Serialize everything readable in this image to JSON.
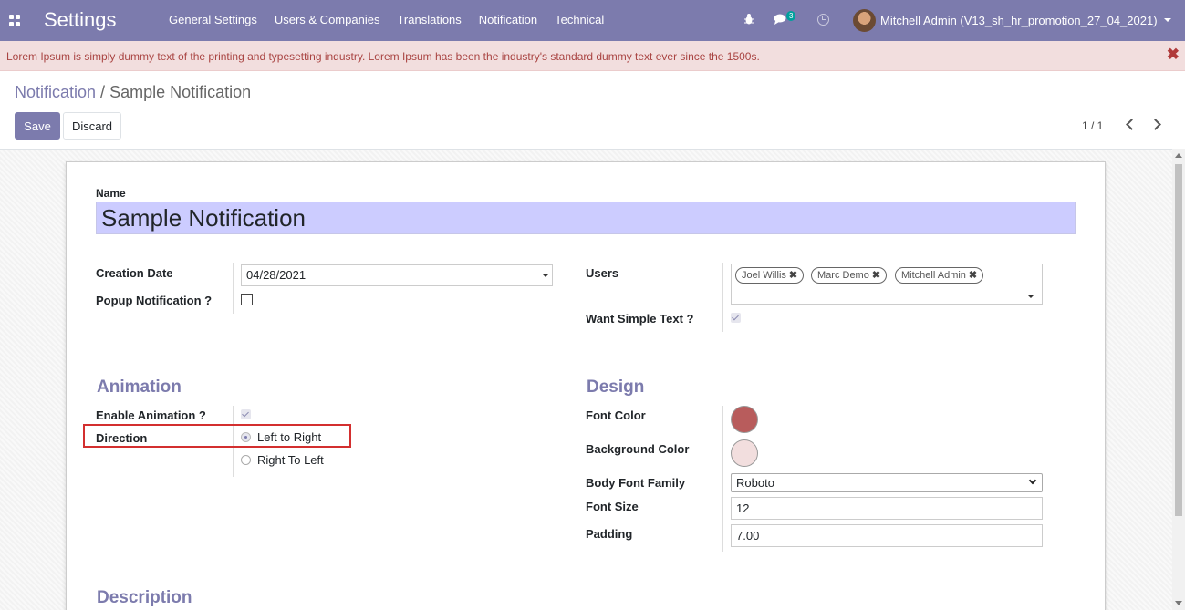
{
  "navbar": {
    "brand": "Settings",
    "menu": [
      "General Settings",
      "Users & Companies",
      "Translations",
      "Notification",
      "Technical"
    ],
    "chat_count": "3",
    "user": "Mitchell Admin (V13_sh_hr_promotion_27_04_2021)",
    "colors": {
      "bar": "#7c7bad"
    },
    "icons": [
      "apps-icon",
      "bug-icon",
      "chat-icon",
      "clock-icon"
    ]
  },
  "alert": {
    "text": "Lorem Ipsum is simply dummy text of the printing and typesetting industry. Lorem Ipsum has been the industry's standard dummy text ever since the 1500s.",
    "close": "✖"
  },
  "breadcrumb": {
    "parent": "Notification",
    "separator": " / ",
    "current": "Sample Notification"
  },
  "buttons": {
    "save": "Save",
    "discard": "Discard"
  },
  "pager": {
    "value": "1 / 1"
  },
  "form": {
    "name_label": "Name",
    "name_value": "Sample Notification",
    "creation_date_label": "Creation Date",
    "creation_date_value": "04/28/2021",
    "popup_label": "Popup Notification ?",
    "popup_checked": false,
    "users_label": "Users",
    "users": [
      "Joel Willis",
      "Marc Demo",
      "Mitchell Admin"
    ],
    "want_simple_text_label": "Want Simple Text ?",
    "want_simple_text_checked": true,
    "animation_title": "Animation",
    "enable_animation_label": "Enable Animation ?",
    "enable_animation_checked": true,
    "direction_label": "Direction",
    "direction_options": [
      "Left to Right",
      "Right To Left"
    ],
    "direction_selected": "Left to Right",
    "design_title": "Design",
    "font_color_label": "Font Color",
    "font_color": "#b85c5c",
    "background_color_label": "Background Color",
    "background_color": "#f2dede",
    "body_font_family_label": "Body Font Family",
    "body_font_family_value": "Roboto",
    "font_size_label": "Font Size",
    "font_size_value": "12",
    "padding_label": "Padding",
    "padding_value": "7.00",
    "description_title": "Description"
  }
}
